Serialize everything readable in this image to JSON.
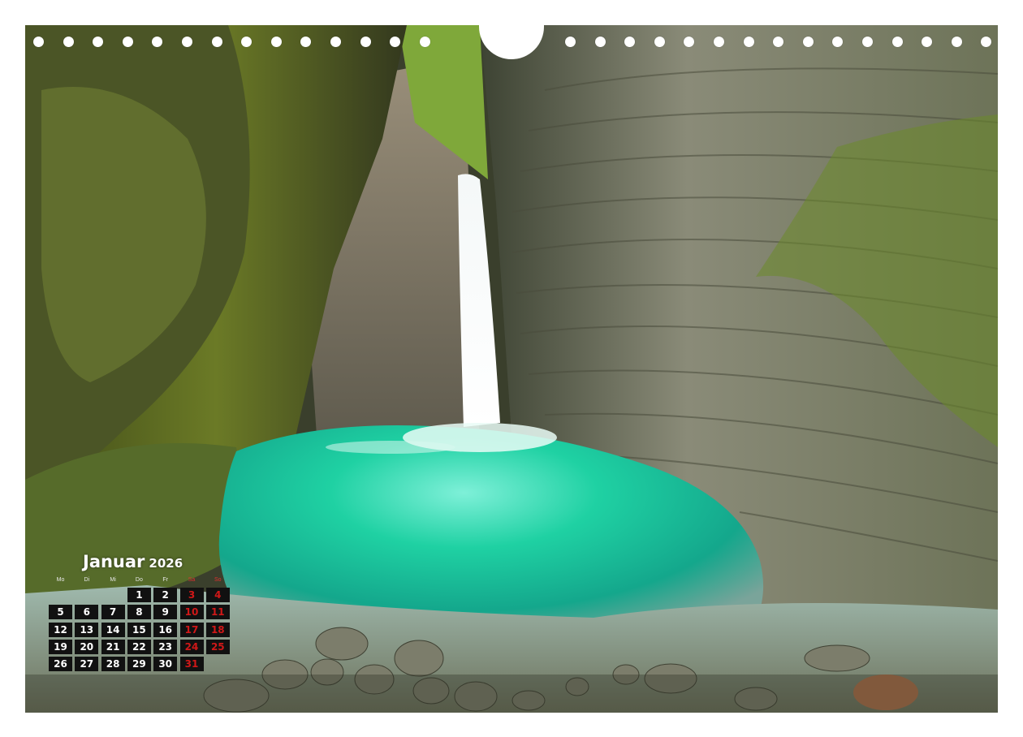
{
  "calendar": {
    "month": "Januar",
    "year": "2026",
    "weekdays": [
      "Mo",
      "Di",
      "Mi",
      "Do",
      "Fr",
      "Sa",
      "So"
    ],
    "first_weekday_index": 3,
    "days_in_month": 31,
    "weekend_color": "#d01818"
  },
  "photo": {
    "subject": "waterfall-canyon",
    "pool_color": "#1fd1a3",
    "rock_color": "#5f6450",
    "moss_color": "#6c8a2a"
  },
  "binding": {
    "hole_count": 32
  }
}
